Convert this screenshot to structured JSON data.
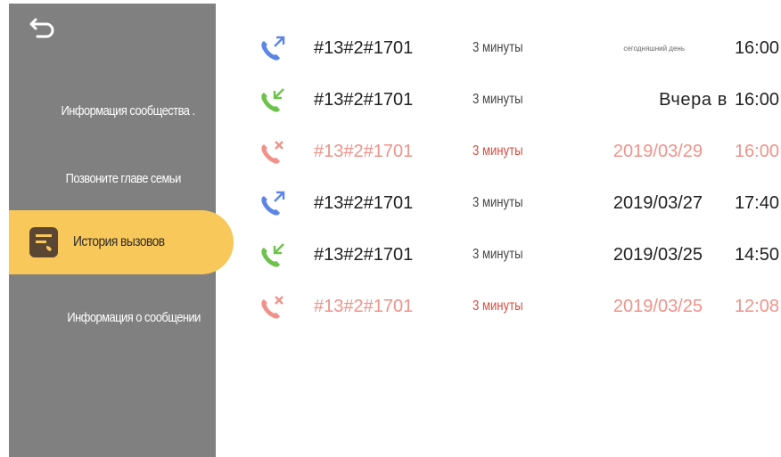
{
  "colors": {
    "sidebar_bg": "#808080",
    "active_bg": "#f9c85b",
    "outgoing": "#5b86e5",
    "incoming": "#6cc24a",
    "missed": "#f0928a"
  },
  "sidebar": {
    "back_icon": "back-arrow-icon",
    "items": [
      {
        "label": "Информация сообщества ."
      },
      {
        "label": "Позвоните главе семьи"
      },
      {
        "label": "История вызовов",
        "active": true,
        "icon": "call-history-icon"
      },
      {
        "label": "Информация о сообщении"
      }
    ]
  },
  "calls": [
    {
      "type": "outgoing",
      "icon": "outgoing-call-icon",
      "number": "#13#2#1701",
      "duration": "3 минуты",
      "date": "сегодняшний день",
      "time": "16:00"
    },
    {
      "type": "incoming",
      "icon": "incoming-call-icon",
      "number": "#13#2#1701",
      "duration": "3 минуты",
      "date": "Вчера в",
      "time": "16:00"
    },
    {
      "type": "missed",
      "icon": "missed-call-icon",
      "number": "#13#2#1701",
      "duration": "3 минуты",
      "date": "2019/03/29",
      "time": "16:00"
    },
    {
      "type": "outgoing",
      "icon": "outgoing-call-icon",
      "number": "#13#2#1701",
      "duration": "3 минуты",
      "date": "2019/03/27",
      "time": "17:40"
    },
    {
      "type": "incoming",
      "icon": "incoming-call-icon",
      "number": "#13#2#1701",
      "duration": "3 минуты",
      "date": "2019/03/25",
      "time": "14:50"
    },
    {
      "type": "missed",
      "icon": "missed-call-icon",
      "number": "#13#2#1701",
      "duration": "3 минуты",
      "date": "2019/03/25",
      "time": "12:08"
    }
  ]
}
